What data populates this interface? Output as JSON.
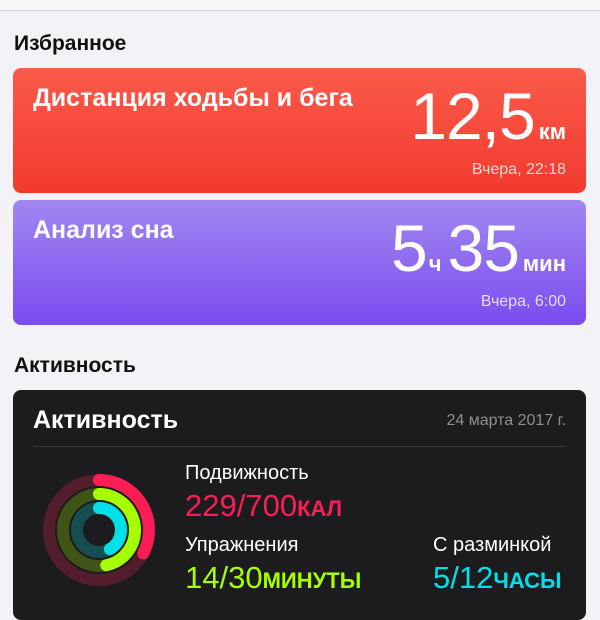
{
  "favorites": {
    "section_title": "Избранное",
    "walking": {
      "title": "Дистанция ходьбы и бега",
      "value": "12,5",
      "unit": "км",
      "subtitle": "Вчера, 22:18"
    },
    "sleep": {
      "title": "Анализ сна",
      "hours": "5",
      "hours_unit": "ч",
      "minutes": "35",
      "minutes_unit": "мин",
      "subtitle": "Вчера, 6:00"
    }
  },
  "activity": {
    "section_title": "Активность",
    "card_title": "Активность",
    "date": "24 марта 2017 г.",
    "move": {
      "label": "Подвижность",
      "value": "229/700",
      "unit": "КАЛ",
      "progress": 0.327,
      "color": "#fa1e54"
    },
    "exercise": {
      "label": "Упражнения",
      "value": "14/30",
      "unit": "МИНУТЫ",
      "progress": 0.467,
      "color": "#a6ff00"
    },
    "stand": {
      "label": "С разминкой",
      "value": "5/12",
      "unit": "ЧАСЫ",
      "progress": 0.417,
      "color": "#00e0e6"
    }
  }
}
